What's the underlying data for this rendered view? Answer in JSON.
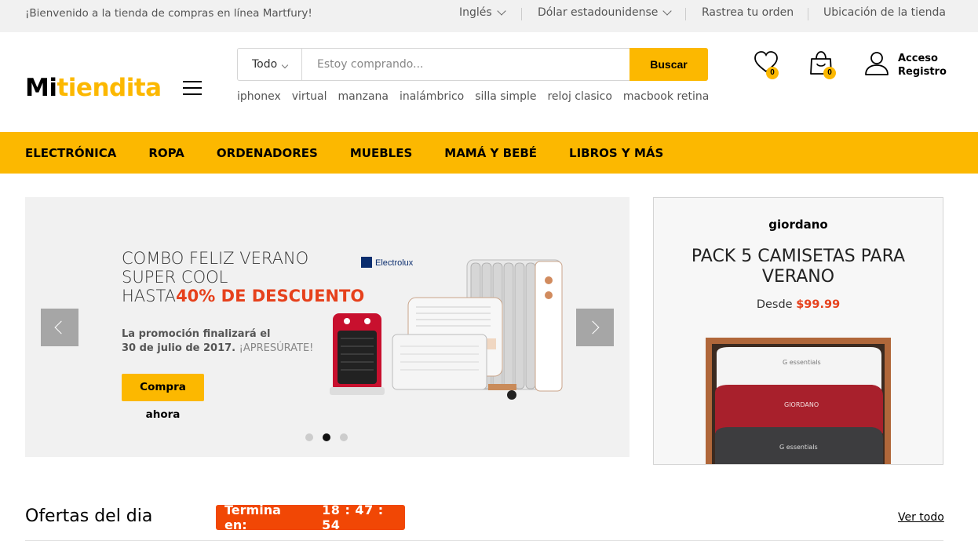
{
  "topbar": {
    "welcome": "¡Bienvenido a la tienda de compras en línea Martfury!",
    "language": "Inglés",
    "currency": "Dólar estadounidense",
    "track_order": "Rastrea tu orden",
    "store_location": "Ubicación de la tienda"
  },
  "header": {
    "logo_part1": "Mi",
    "logo_part2": "tiendita",
    "search": {
      "category": "Todo",
      "placeholder": "Estoy comprando...",
      "button": "Buscar"
    },
    "suggestions": [
      "iphonex",
      "virtual",
      "manzana",
      "inalámbrico",
      "silla simple",
      "reloj clasico",
      "macbook retina"
    ],
    "wishlist_count": "0",
    "cart_count": "0",
    "account_login": "Acceso",
    "account_register": "Registro"
  },
  "nav": {
    "items": [
      "ELECTRÓNICA",
      "ROPA",
      "ORDENADORES",
      "MUEBLES",
      "MAMÁ Y BEBÉ",
      "LIBROS Y MÁS"
    ]
  },
  "banner": {
    "line1": "COMBO FELIZ VERANO",
    "line2": "SUPER COOL",
    "line3_prefix": "HASTA",
    "line3_discount": "40% DE DESCUENTO",
    "promo_line1": "La promoción finalizará el",
    "promo_line2": "30 de julio de 2017.",
    "promo_hurry": "¡APRESÚRATE!",
    "button": "Compra ahora",
    "brand_logo": "Electrolux",
    "active_slide": 2,
    "slide_count": 3
  },
  "side_promo": {
    "brand": "giordano",
    "title_line1": "PACK 5 CAMISETAS PARA",
    "title_line2": "VERANO",
    "price_prefix": "Desde",
    "price": "$99.99",
    "shirt_label_1": "G essentials",
    "shirt_label_2": "GIORDANO",
    "shirt_label_3": "G essentials"
  },
  "deals": {
    "title": "Ofertas del dia",
    "timer_label": "Termina en:",
    "timer_value": "18 : 47 : 54",
    "view_all": "Ver todo"
  },
  "colors": {
    "accent": "#fcb800",
    "discount": "#e6411c",
    "timer_bg": "#f14705"
  }
}
